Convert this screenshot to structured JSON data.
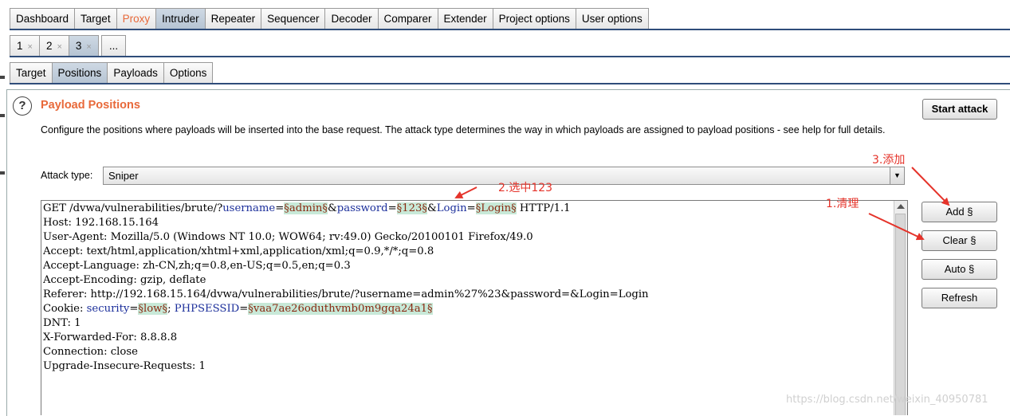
{
  "main_tabs": [
    "Dashboard",
    "Target",
    "Proxy",
    "Intruder",
    "Repeater",
    "Sequencer",
    "Decoder",
    "Comparer",
    "Extender",
    "Project options",
    "User options"
  ],
  "intruder_tabs": [
    "1",
    "2",
    "3"
  ],
  "intruder_tab_close": "×",
  "intruder_tab_more": "...",
  "sub_tabs": [
    "Target",
    "Positions",
    "Payloads",
    "Options"
  ],
  "panel": {
    "help_glyph": "?",
    "title": "Payload Positions",
    "description": "Configure the positions where payloads will be inserted into the base request. The attack type determines the way in which payloads are assigned to payload positions - see help for full details.",
    "attack_type_label": "Attack type:",
    "attack_type_value": "Sniper",
    "start_attack": "Start attack"
  },
  "side_buttons": {
    "add": "Add §",
    "clear": "Clear §",
    "auto": "Auto §",
    "refresh": "Refresh"
  },
  "request": {
    "line1": {
      "prefix": "GET /dvwa/vulnerabilities/brute/?",
      "p1": "username",
      "eq1": "=",
      "v1": "§admin§",
      "amp1": "&",
      "p2": "password",
      "eq2": "=",
      "v2": "§123§",
      "amp2": "&",
      "p3": "Login",
      "eq3": "=",
      "v3": "§Login§",
      "suffix": " HTTP/1.1"
    },
    "lines": [
      "Host: 192.168.15.164",
      "User-Agent: Mozilla/5.0 (Windows NT 10.0; WOW64; rv:49.0) Gecko/20100101 Firefox/49.0",
      "Accept: text/html,application/xhtml+xml,application/xml;q=0.9,*/*;q=0.8",
      "Accept-Language: zh-CN,zh;q=0.8,en-US;q=0.5,en;q=0.3",
      "Accept-Encoding: gzip, deflate",
      "Referer: http://192.168.15.164/dvwa/vulnerabilities/brute/?username=admin%27%23&password=&Login=Login"
    ],
    "cookie": {
      "label": "Cookie: ",
      "k1": "security",
      "eq1": "=",
      "v1": "§low§",
      "sep": "; ",
      "k2": "PHPSESSID",
      "eq2": "=",
      "v2": "§vaa7ae26oduthvmb0m9gqa24a1§"
    },
    "lines_after": [
      "DNT: 1",
      "X-Forwarded-For: 8.8.8.8",
      "Connection: close",
      "Upgrade-Insecure-Requests: 1"
    ]
  },
  "annotations": {
    "add": "3.添加",
    "select": "2.选中123",
    "clear": "1.清理"
  },
  "watermark": "https://blog.csdn.net/weixin_40950781",
  "colors": {
    "accent_orange": "#e8693a",
    "annotation_red": "#e5332a",
    "payload_marker_bg": "#c8e9d8",
    "param_blue": "#1c2f9b",
    "active_tab": "#b6c4d3"
  }
}
